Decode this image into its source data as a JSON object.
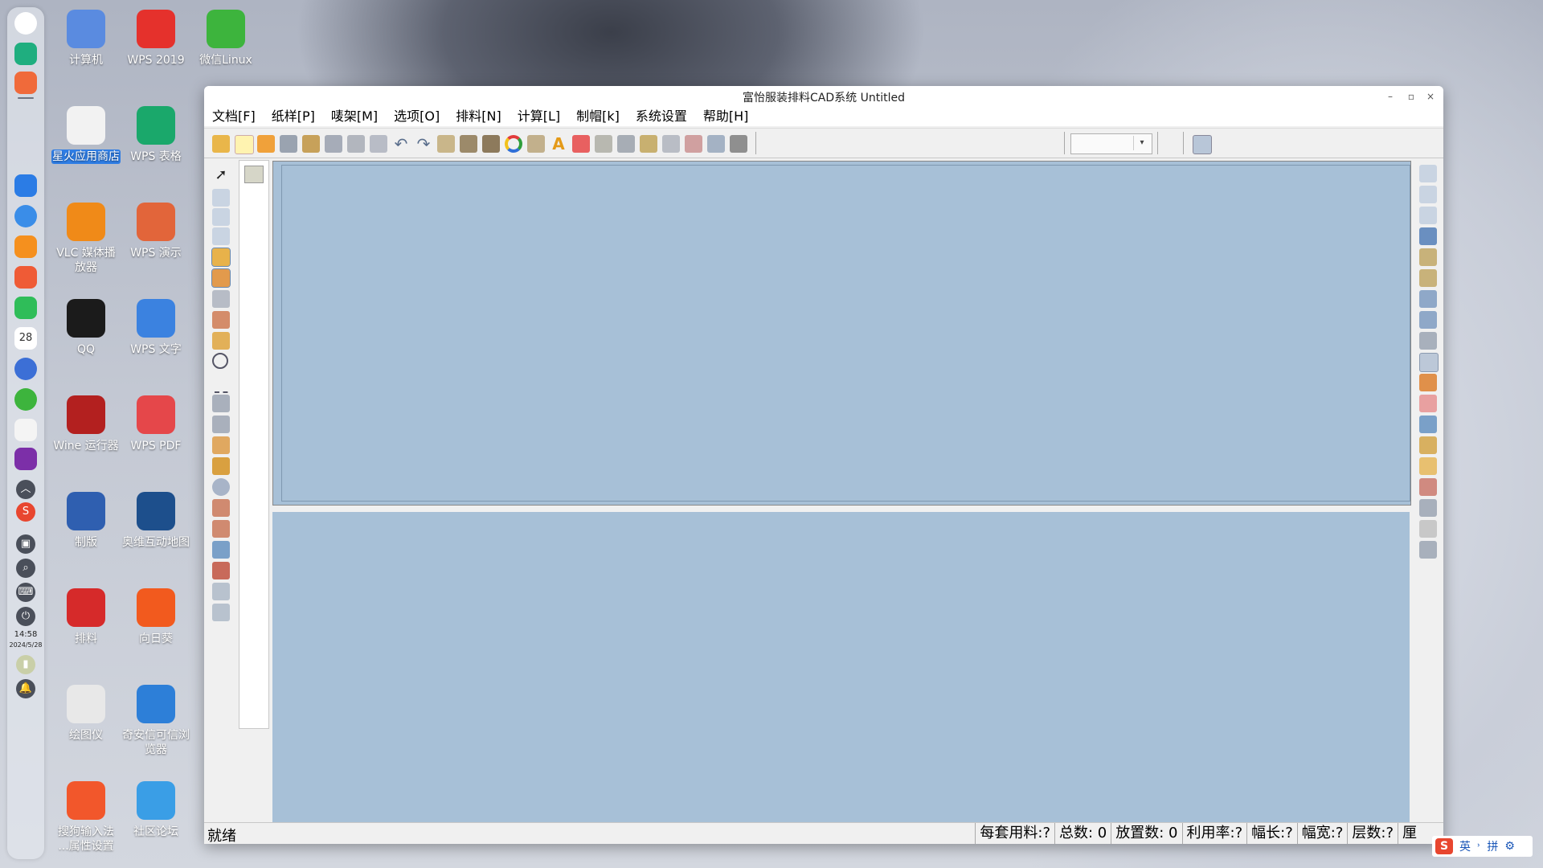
{
  "dock": {
    "clock_time": "14:58",
    "clock_date": "2024/5/28",
    "calendar_day": "28"
  },
  "desktop_icons": [
    {
      "label": "计算机",
      "icon": "computer-icon",
      "color": "#5a8be0"
    },
    {
      "label": "WPS 2019",
      "icon": "wps-icon",
      "color": "#e5312c"
    },
    {
      "label": "微信Linux",
      "icon": "wechat-icon",
      "color": "#3db43d"
    },
    {
      "label": "星火应用商店",
      "icon": "spark-store-icon",
      "color": "#f2f2f2"
    },
    {
      "label": "WPS 表格",
      "icon": "wps-spreadsheet-icon",
      "color": "#1aa86b"
    },
    {
      "label": "VLC 媒体播放器",
      "icon": "vlc-icon",
      "color": "#f08a18"
    },
    {
      "label": "WPS 演示",
      "icon": "wps-presentation-icon",
      "color": "#e2653a"
    },
    {
      "label": "QQ",
      "icon": "qq-icon",
      "color": "#1b1b1b"
    },
    {
      "label": "WPS 文字",
      "icon": "wps-writer-icon",
      "color": "#3b82e0"
    },
    {
      "label": "Wine 运行器",
      "icon": "wine-icon",
      "color": "#b3201f"
    },
    {
      "label": "WPS PDF",
      "icon": "wps-pdf-icon",
      "color": "#e5474a"
    },
    {
      "label": "制版",
      "icon": "pattern-making-icon",
      "color": "#2f5fb0"
    },
    {
      "label": "奥维互动地图",
      "icon": "ovital-map-icon",
      "color": "#1d4f8c"
    },
    {
      "label": "排料",
      "icon": "marker-layout-icon",
      "color": "#d62a2a"
    },
    {
      "label": "向日葵",
      "icon": "sunlogin-icon",
      "color": "#f25a1e"
    },
    {
      "label": "绘图仪",
      "icon": "plotter-icon",
      "color": "#e8e8e8"
    },
    {
      "label": "奇安信可信浏览器",
      "icon": "qianxin-browser-icon",
      "color": "#2d7fd8"
    },
    {
      "label": "搜狗输入法 ...属性设置",
      "icon": "sogou-icon",
      "color": "#f2572b"
    },
    {
      "label": "社区论坛",
      "icon": "forum-icon",
      "color": "#3a9ee6"
    }
  ],
  "window": {
    "title": "富怡服装排料CAD系统 Untitled",
    "menu": [
      "文档[F]",
      "纸样[P]",
      "唛架[M]",
      "选项[O]",
      "排料[N]",
      "计算[L]",
      "制帽[k]",
      "系统设置",
      "帮助[H]"
    ],
    "status": {
      "ready": "就绪",
      "cells": [
        "每套用料:?",
        "总数: 0",
        "放置数: 0",
        "利用率:?",
        "幅长:?",
        "幅宽:?",
        "层数:?",
        "厘"
      ]
    }
  },
  "ime": {
    "lang": "英",
    "mode": "拼"
  }
}
